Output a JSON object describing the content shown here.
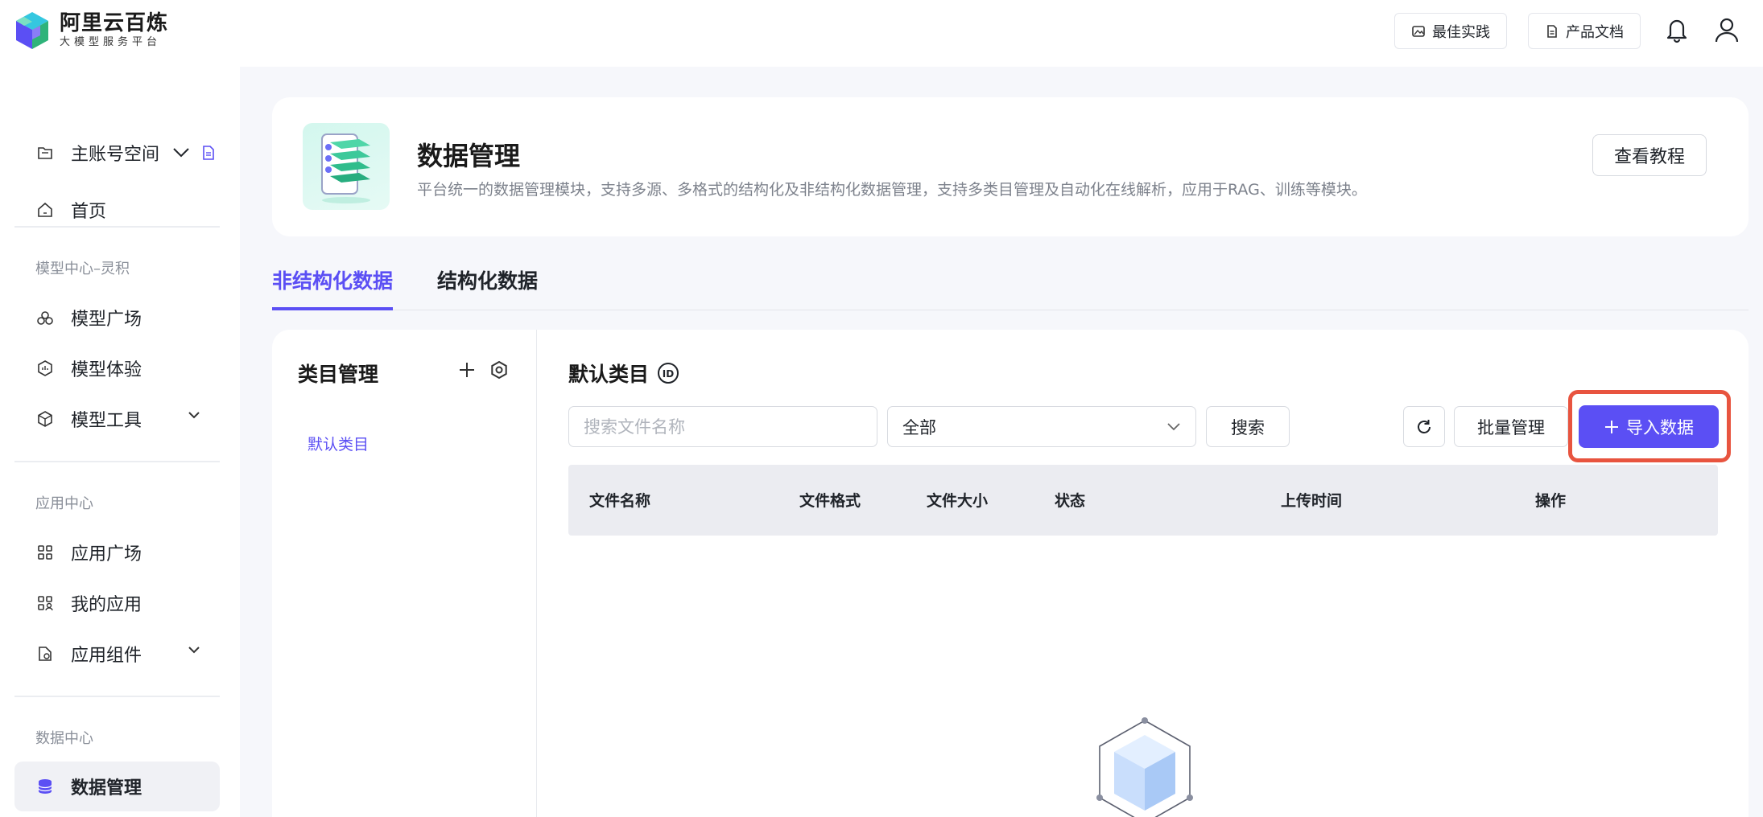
{
  "brand": {
    "title": "阿里云百炼",
    "subtitle": "大模型服务平台"
  },
  "topbar": {
    "best_practice": "最佳实践",
    "product_docs": "产品文档",
    "icons": [
      "bell-icon",
      "user-icon"
    ]
  },
  "sidebar": {
    "workspace": "主账号空间",
    "home": "首页",
    "section_model": "模型中心–灵积",
    "model_square": "模型广场",
    "model_experience": "模型体验",
    "model_tools": "模型工具",
    "section_app": "应用中心",
    "app_square": "应用广场",
    "my_apps": "我的应用",
    "app_components": "应用组件",
    "section_data": "数据中心",
    "data_management": "数据管理"
  },
  "header": {
    "title": "数据管理",
    "description": "平台统一的数据管理模块，支持多源、多格式的结构化及非结构化数据管理，支持多类目管理及自动化在线解析，应用于RAG、训练等模块。",
    "tutorial_button": "查看教程"
  },
  "tabs": [
    {
      "label": "非结构化数据",
      "active": true
    },
    {
      "label": "结构化数据",
      "active": false
    }
  ],
  "categories": {
    "title": "类目管理",
    "items": [
      "默认类目"
    ]
  },
  "list": {
    "title": "默认类目",
    "search_placeholder": "搜索文件名称",
    "filter_value": "全部",
    "search_button": "搜索",
    "batch_button": "批量管理",
    "import_button": "导入数据",
    "columns": [
      "文件名称",
      "文件格式",
      "文件大小",
      "状态",
      "上传时间",
      "操作"
    ]
  },
  "colors": {
    "accent": "#5b4ff4",
    "highlight": "#e8543f"
  }
}
